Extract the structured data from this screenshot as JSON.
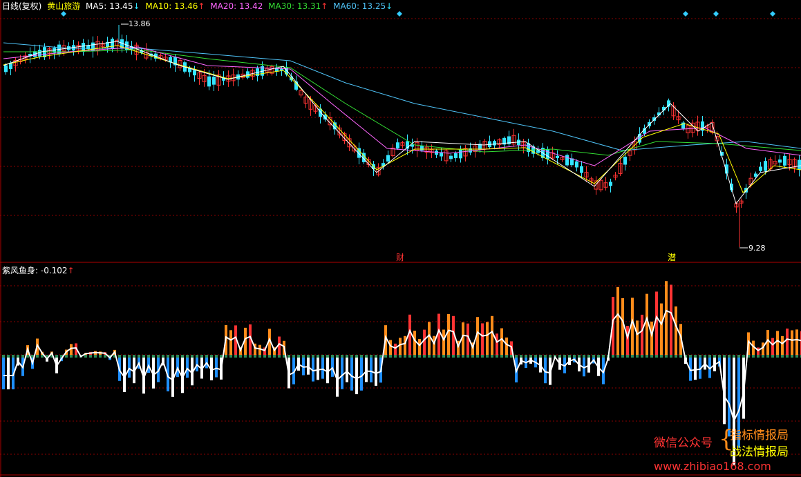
{
  "header": {
    "title": "日线(复权)",
    "stock": "黄山旅游",
    "ma": [
      {
        "label": "MA5: 13.45",
        "arrow": "↓",
        "color": "#ffffff"
      },
      {
        "label": "MA10: 13.46",
        "arrow": "↑",
        "color": "#ffff00"
      },
      {
        "label": "MA20: 13.42",
        "arrow": "",
        "color": "#ff66ff"
      },
      {
        "label": "MA30: 13.31",
        "arrow": "↑",
        "color": "#33dd33"
      },
      {
        "label": "MA60: 13.25",
        "arrow": "↓",
        "color": "#4fc3f7"
      }
    ]
  },
  "price_chart": {
    "high_label": "13.86",
    "low_label": "9.28",
    "marker_cai": "财",
    "marker_qian": "潜"
  },
  "indicator": {
    "name": "紫风鱼身",
    "value": "-0.102",
    "arrow": "↑"
  },
  "watermark": {
    "wechat": "微信公众号",
    "brace": "{",
    "line1": "指标情报局",
    "line2": "战法情报局",
    "url": "www.zhibiao168.com"
  },
  "colors": {
    "up": "#ff3333",
    "down": "#33e5ff",
    "orange": "#ff8c1a",
    "blue": "#1e8fff",
    "green": "#2e8b57",
    "grid": "#8b0000"
  }
}
